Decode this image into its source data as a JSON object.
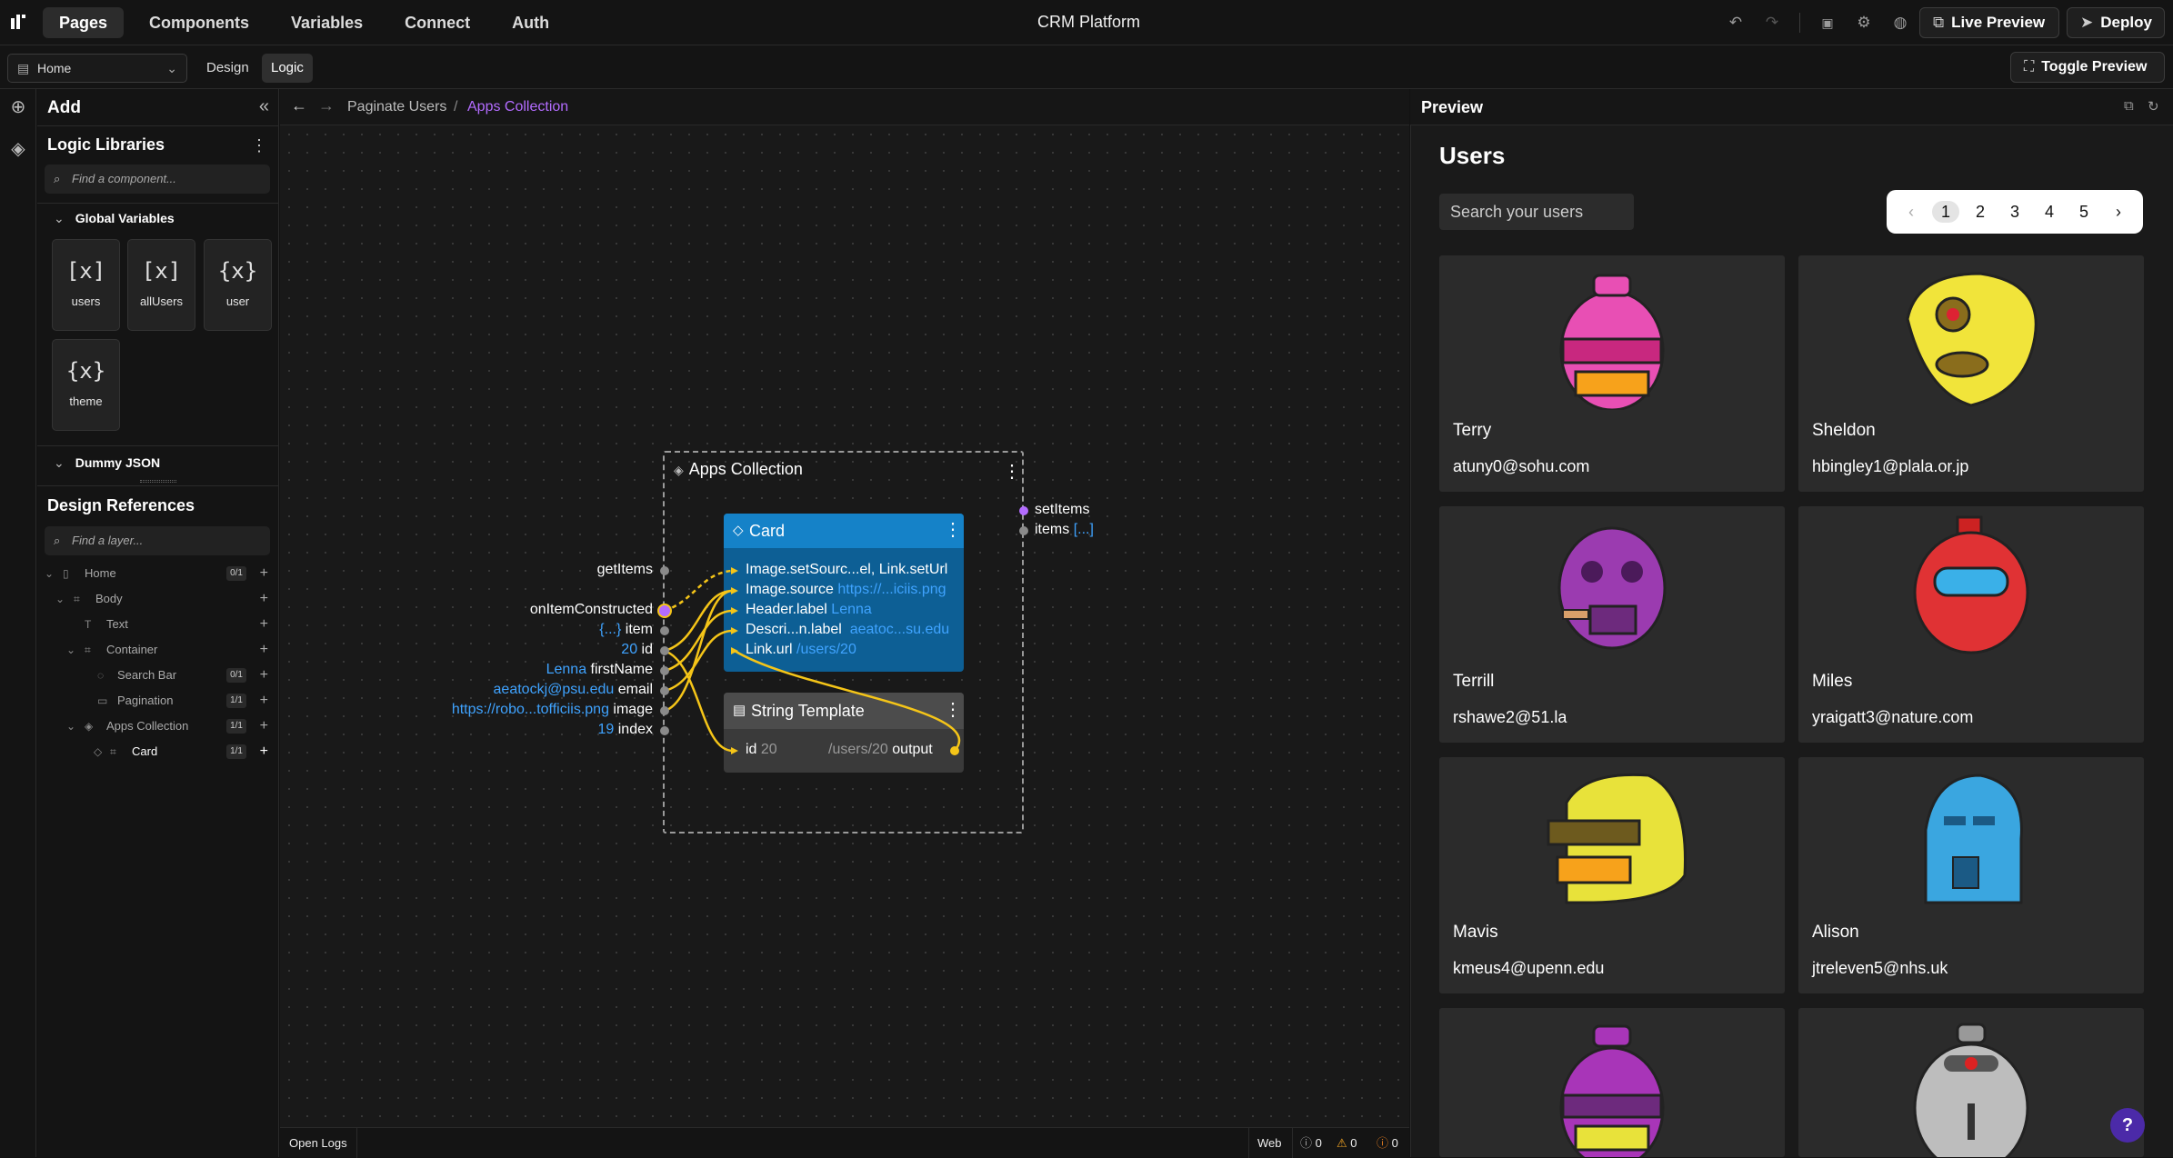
{
  "topbar": {
    "tabs": [
      "Pages",
      "Components",
      "Variables",
      "Connect",
      "Auth"
    ],
    "app_title": "CRM Platform",
    "live_preview_label": "Live Preview",
    "deploy_label": "Deploy"
  },
  "subbar": {
    "page_select": "Home",
    "modes": [
      "Design",
      "Logic"
    ],
    "toggle_preview_label": "Toggle Preview"
  },
  "left_panel": {
    "add_title": "Add",
    "libraries_title": "Logic Libraries",
    "component_search_placeholder": "Find a component...",
    "global_variables_label": "Global Variables",
    "variables": [
      "users",
      "allUsers",
      "user",
      "theme"
    ],
    "dummy_json_label": "Dummy JSON",
    "design_refs_title": "Design References",
    "layer_search_placeholder": "Find a layer...",
    "tree": [
      {
        "label": "Home",
        "badge": "0/1"
      },
      {
        "label": "Body",
        "badge": ""
      },
      {
        "label": "Text",
        "badge": ""
      },
      {
        "label": "Container",
        "badge": ""
      },
      {
        "label": "Search Bar",
        "badge": "0/1"
      },
      {
        "label": "Pagination",
        "badge": "1/1"
      },
      {
        "label": "Apps Collection",
        "badge": "1/1"
      },
      {
        "label": "Card",
        "badge": "1/1"
      }
    ]
  },
  "breadcrumb": {
    "parent": "Paginate Users",
    "separator": "/",
    "current": "Apps Collection"
  },
  "flow": {
    "frame_title": "Apps Collection",
    "frame_outputs": [
      {
        "label": "setItems",
        "value": ""
      },
      {
        "label": "items",
        "value": "[...]"
      }
    ],
    "inputs": [
      {
        "value": "",
        "label": "getItems"
      },
      {
        "value": "",
        "label": "onItemConstructed"
      },
      {
        "value": "{...}",
        "label": "item"
      },
      {
        "value": "20",
        "label": "id"
      },
      {
        "value": "Lenna",
        "label": "firstName"
      },
      {
        "value": "aeatockj@psu.edu",
        "label": "email"
      },
      {
        "value": "https://robo...tofficiis.png",
        "label": "image"
      },
      {
        "value": "19",
        "label": "index"
      }
    ],
    "card_title": "Card",
    "card_ports": [
      {
        "label": "Image.setSourc...el, Link.setUrl",
        "value": ""
      },
      {
        "label": "Image.source",
        "value": "https://...iciis.png"
      },
      {
        "label": "Header.label",
        "value": "Lenna"
      },
      {
        "label": "Descri...n.label",
        "value": "aeatoc...su.edu"
      },
      {
        "label": "Link.url",
        "value": "/users/20"
      }
    ],
    "string_template_title": "String Template",
    "st_input_label": "id",
    "st_input_value": "20",
    "st_output_value": "/users/20",
    "st_output_label": "output"
  },
  "bottombar": {
    "open_logs": "Open Logs",
    "platform": "Web",
    "info_count": "0",
    "warn_count": "0",
    "error_count": "0"
  },
  "preview": {
    "title": "Preview",
    "page_title": "Users",
    "search_placeholder": "Search your users",
    "pages": [
      "1",
      "2",
      "3",
      "4",
      "5"
    ],
    "current_page": "1",
    "users": [
      {
        "name": "Terry",
        "email": "atuny0@sohu.com",
        "color": "#e84fb4"
      },
      {
        "name": "Sheldon",
        "email": "hbingley1@plala.or.jp",
        "color": "#f1e43a"
      },
      {
        "name": "Terrill",
        "email": "rshawe2@51.la",
        "color": "#9b3bb0"
      },
      {
        "name": "Miles",
        "email": "yraigatt3@nature.com",
        "color": "#e03234"
      },
      {
        "name": "Mavis",
        "email": "kmeus4@upenn.edu",
        "color": "#e8e23a"
      },
      {
        "name": "Alison",
        "email": "jtreleven5@nhs.uk",
        "color": "#3aa6e0"
      },
      {
        "name": "",
        "email": "",
        "color": "#a835b8"
      },
      {
        "name": "",
        "email": "",
        "color": "#bdbdbd"
      }
    ],
    "colors": {
      "port_line": "#f5c518",
      "card": "#1582c8",
      "accent_link": "#b36cff"
    }
  }
}
